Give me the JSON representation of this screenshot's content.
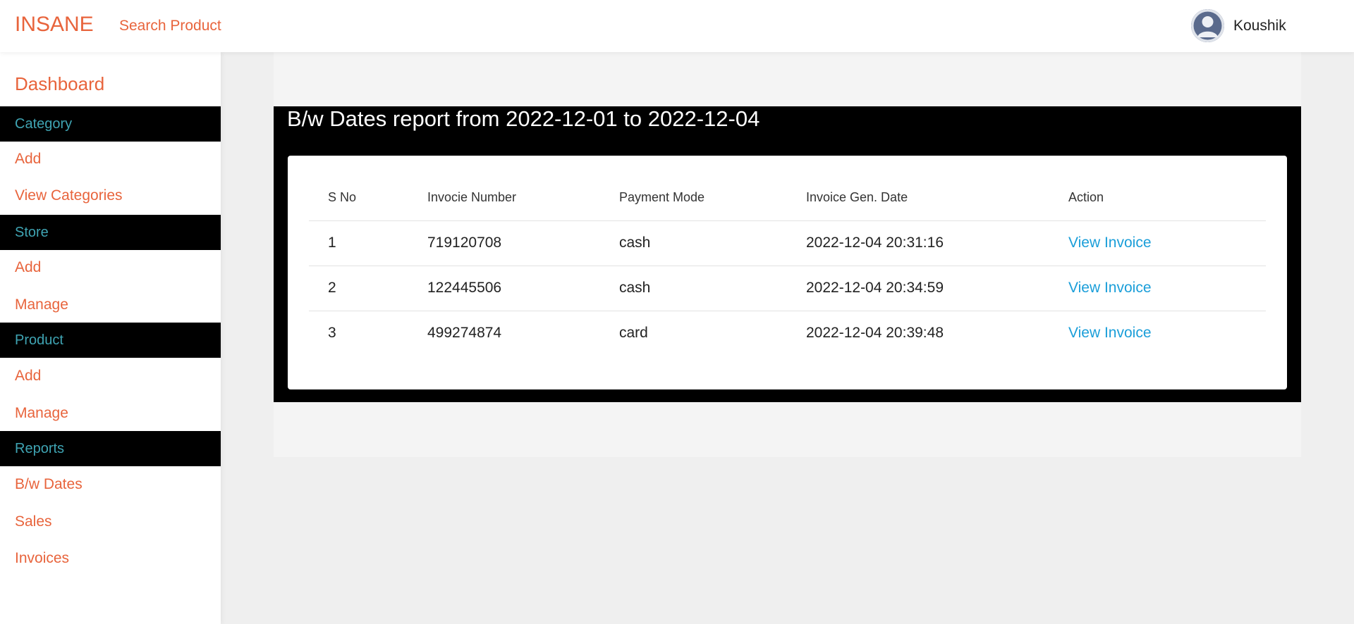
{
  "header": {
    "brand": "INSANE",
    "search_link": "Search Product",
    "user_name": "Koushik",
    "avatar_icon": "user-avatar-icon"
  },
  "sidebar": {
    "title": "Dashboard",
    "sections": [
      {
        "label": "Category",
        "items": [
          "Add",
          "View Categories"
        ]
      },
      {
        "label": "Store",
        "items": [
          "Add",
          "Manage"
        ]
      },
      {
        "label": "Product",
        "items": [
          "Add",
          "Manage"
        ]
      },
      {
        "label": "Reports",
        "items": [
          "B/w Dates",
          "Sales",
          "Invoices"
        ]
      }
    ]
  },
  "report": {
    "title": "B/w Dates report from 2022-12-01 to 2022-12-04",
    "columns": [
      "S No",
      "Invocie Number",
      "Payment Mode",
      "Invoice Gen. Date",
      "Action"
    ],
    "rows": [
      {
        "sno": "1",
        "invoice": "719120708",
        "mode": "cash",
        "date": "2022-12-04 20:31:16",
        "action": "View Invoice"
      },
      {
        "sno": "2",
        "invoice": "122445506",
        "mode": "cash",
        "date": "2022-12-04 20:34:59",
        "action": "View Invoice"
      },
      {
        "sno": "3",
        "invoice": "499274874",
        "mode": "card",
        "date": "2022-12-04 20:39:48",
        "action": "View Invoice"
      }
    ]
  },
  "colors": {
    "accent": "#e8643c",
    "section_text": "#3fa4b3",
    "link": "#1a9ed9"
  }
}
